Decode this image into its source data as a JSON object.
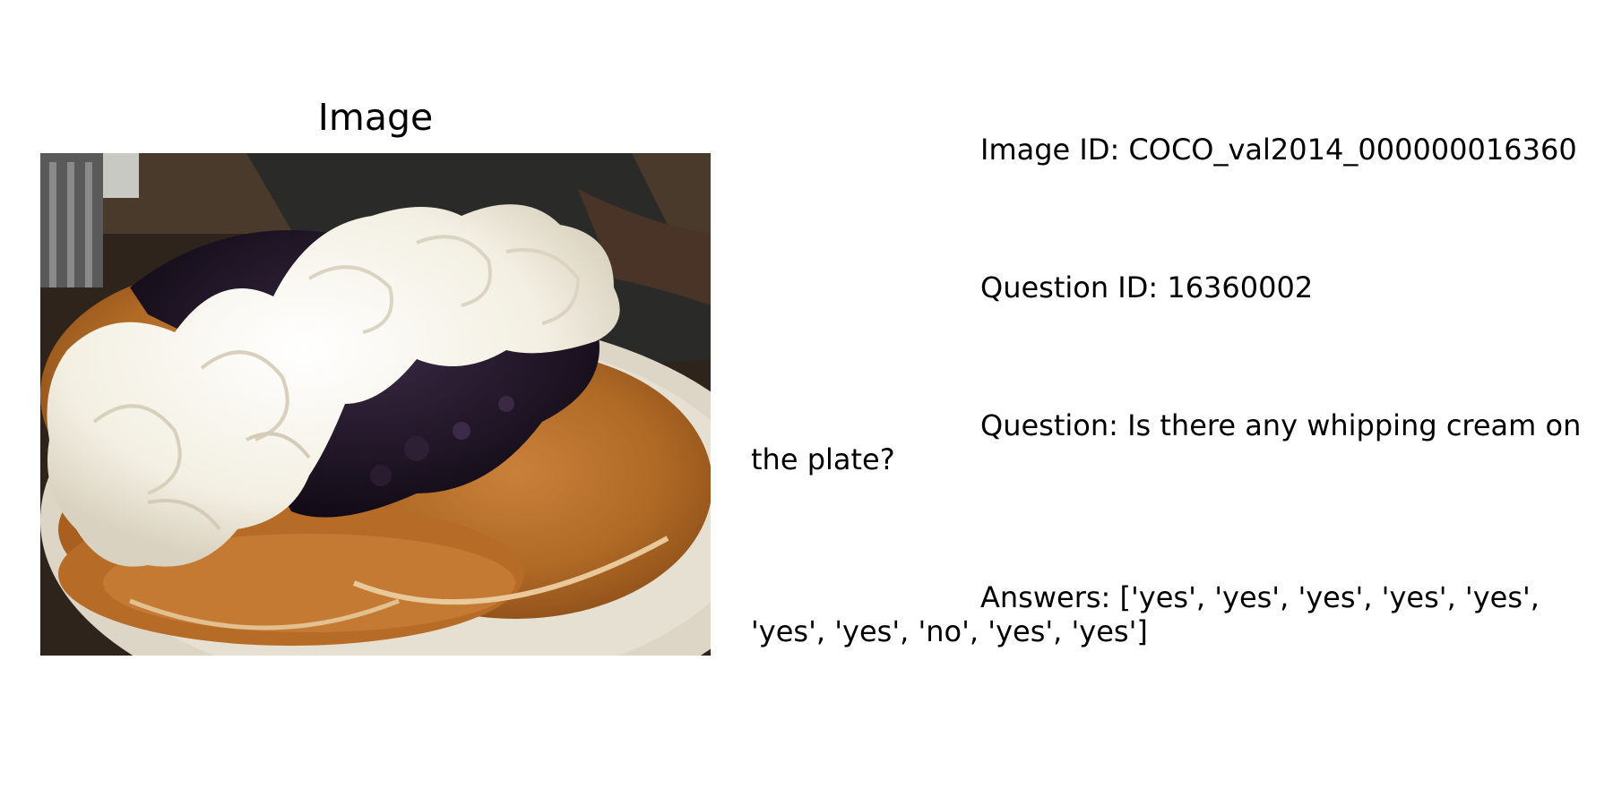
{
  "panel": {
    "title": "Image",
    "photo_subject": "stack of pancakes topped with whipped cream and blueberry compote on a white plate"
  },
  "info": {
    "image_id": "Image ID: COCO_val2014_000000016360",
    "question_id": "Question ID: 16360002",
    "question": "Question: Is there any whipping cream on the plate?",
    "answers": "Answers: ['yes', 'yes', 'yes', 'yes', 'yes', 'yes', 'yes', 'no', 'yes', 'yes']"
  },
  "colors": {
    "background": "#ffffff",
    "text": "#000000",
    "pancake": "#b8702a",
    "cream": "#f7f4ea",
    "blueberry": "#1f1424",
    "plate": "#ded8c8"
  }
}
